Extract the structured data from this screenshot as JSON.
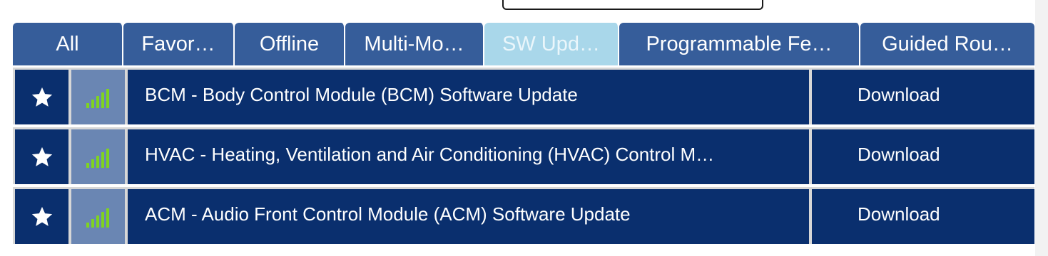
{
  "tabs": [
    {
      "label": "All",
      "active": false
    },
    {
      "label": "Favor…",
      "active": false
    },
    {
      "label": "Offline",
      "active": false
    },
    {
      "label": "Multi-Mo…",
      "active": false
    },
    {
      "label": "SW Upd…",
      "active": true
    },
    {
      "label": "Programmable Fe…",
      "active": false
    },
    {
      "label": "Guided Rou…",
      "active": false
    }
  ],
  "rows": [
    {
      "title": "BCM - Body Control Module (BCM) Software Update",
      "action": "Download",
      "star_icon": "star-icon",
      "signal_icon": "signal-bars-icon"
    },
    {
      "title": "HVAC - Heating, Ventilation and Air Conditioning (HVAC) Control M…",
      "action": "Download",
      "star_icon": "star-icon",
      "signal_icon": "signal-bars-icon"
    },
    {
      "title": "ACM - Audio Front Control Module (ACM) Software Update",
      "action": "Download",
      "star_icon": "star-icon",
      "signal_icon": "signal-bars-icon"
    }
  ],
  "colors": {
    "tab_bg": "#365d9a",
    "tab_active_bg": "#a9d7ea",
    "row_bg": "#0a2f6e",
    "signal_cell_bg": "#6a86b3",
    "signal_bars": "#7fd321",
    "separator": "#d7d7d7"
  }
}
